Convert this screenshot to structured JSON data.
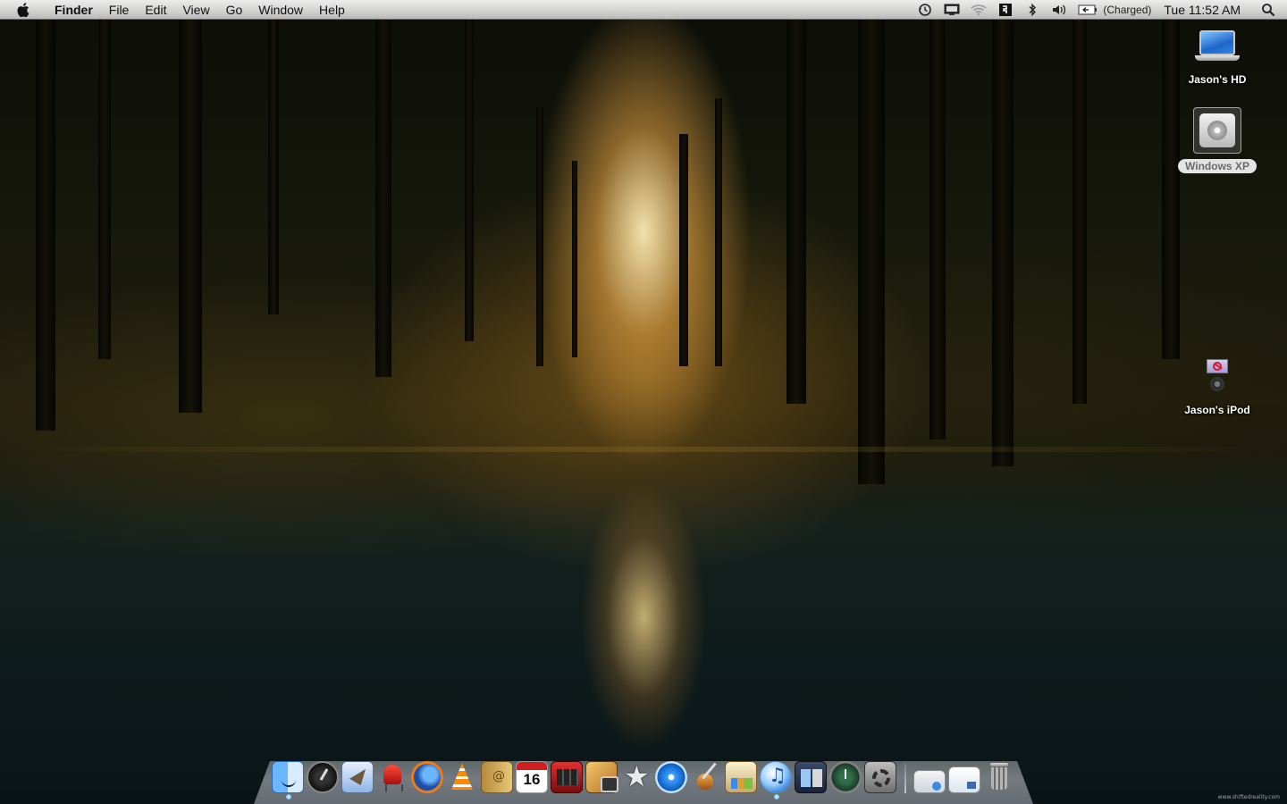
{
  "menubar": {
    "app_name": "Finder",
    "menus": [
      "File",
      "Edit",
      "View",
      "Go",
      "Window",
      "Help"
    ],
    "battery_status": "(Charged)",
    "clock": "Tue 11:52 AM",
    "status_icons": [
      "time-machine-icon",
      "display-icon",
      "wifi-icon",
      "input-menu-icon",
      "bluetooth-icon",
      "volume-icon",
      "battery-icon",
      "spotlight-icon"
    ]
  },
  "desktop": {
    "icons": [
      {
        "label": "Jason's HD",
        "icon": "laptop-hd-icon"
      },
      {
        "label": "Windows XP",
        "icon": "hard-drive-icon",
        "selected": true
      },
      {
        "label": "Jason's iPod",
        "icon": "ipod-icon"
      }
    ]
  },
  "dock": {
    "apps": [
      "finder",
      "dashboard",
      "mail",
      "chair-app",
      "firefox",
      "vlc",
      "address-book",
      "ical",
      "photo-booth",
      "iphoto",
      "imovie",
      "idvd",
      "garageband",
      "iweb",
      "itunes",
      "spaces",
      "time-machine",
      "system-preferences"
    ],
    "ical_day": "16",
    "stacks": [
      "downloads-stack",
      "documents-stack"
    ],
    "trash": "trash"
  },
  "wallpaper": {
    "credit": "www.shiftedreality.com"
  },
  "colors": {
    "menubar": "#e9e9e9",
    "selection": "#e4e4e4"
  }
}
